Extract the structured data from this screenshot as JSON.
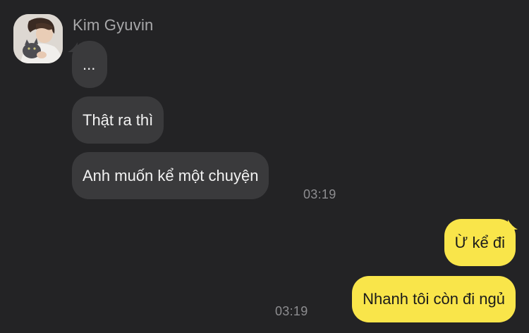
{
  "contact": {
    "name": "Kim Gyuvin"
  },
  "messages": {
    "incoming": [
      {
        "text": "..."
      },
      {
        "text": "Thật ra thì"
      },
      {
        "text": "Anh muốn kể một chuyện"
      }
    ],
    "incoming_time": "03:19",
    "outgoing": [
      {
        "text": "Ừ kể đi"
      },
      {
        "text": "Nhanh tôi còn đi ngủ"
      }
    ],
    "outgoing_time": "03:19"
  },
  "colors": {
    "background": "#232325",
    "incoming_bubble": "#3a3a3c",
    "outgoing_bubble": "#f9e54a",
    "timestamp": "#8d8d90"
  },
  "icons": {
    "avatar": "profile-photo"
  }
}
